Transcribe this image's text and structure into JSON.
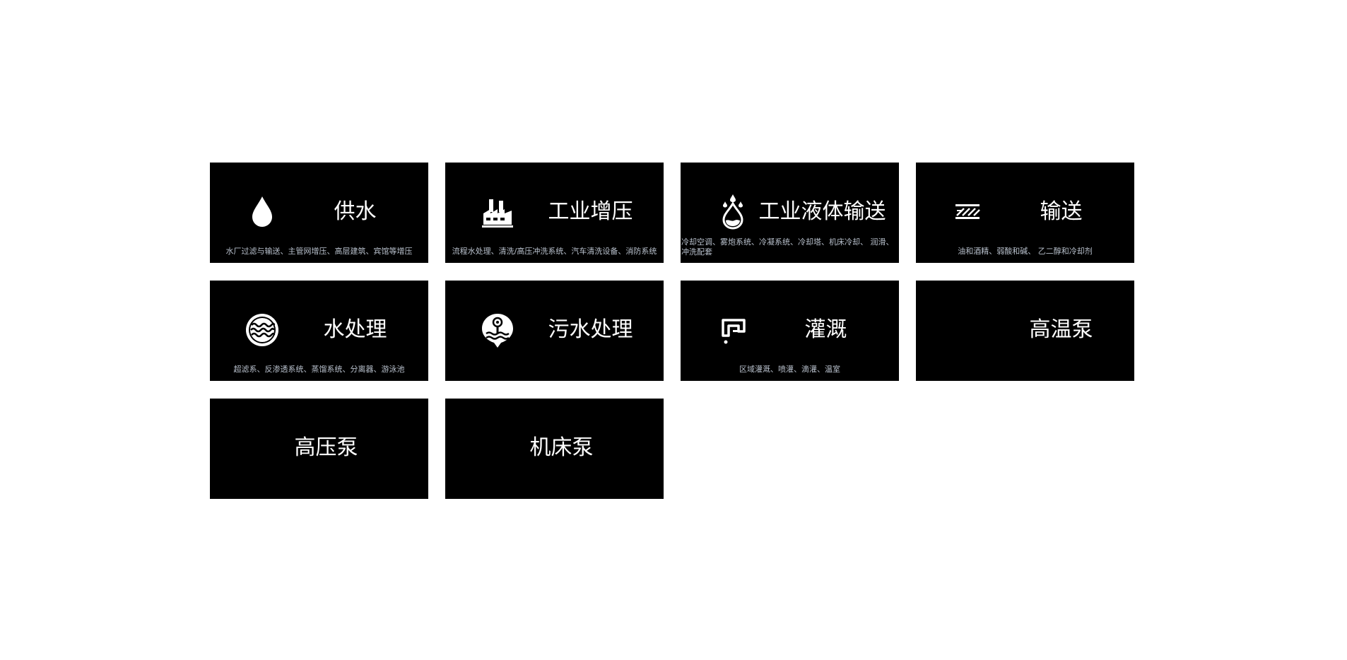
{
  "cards": [
    {
      "title": "供水",
      "desc": "水厂过滤与输送、主管网增压、高层建筑、宾馆等增压",
      "icon": "water-drop-icon"
    },
    {
      "title": "工业增压",
      "desc": "流程水处理、清洗/高压冲洗系统、汽车清洗设备、消防系统",
      "icon": "factory-icon"
    },
    {
      "title": "工业液体输送",
      "desc": "冷却空调、雾炮系统、冷凝系统、冷却塔、机床冷却、 润滑、冲洗配套",
      "icon": "liquid-drops-icon"
    },
    {
      "title": "输送",
      "desc": "油和酒精、弱酸和碱、 乙二醇和冷却剂",
      "icon": "pipeline-icon"
    },
    {
      "title": "水处理",
      "desc": "超滤系、反渗透系统、蒸馏系统、分离器、游泳池",
      "icon": "water-waves-icon"
    },
    {
      "title": "污水处理",
      "desc": "",
      "icon": "sewage-treatment-icon"
    },
    {
      "title": "灌溉",
      "desc": "区域灌溉、喷灌、滴灌、温室",
      "icon": "faucet-icon"
    },
    {
      "title": "高温泵",
      "desc": "",
      "icon": ""
    },
    {
      "title": "高压泵",
      "desc": "",
      "icon": ""
    },
    {
      "title": "机床泵",
      "desc": "",
      "icon": ""
    }
  ]
}
